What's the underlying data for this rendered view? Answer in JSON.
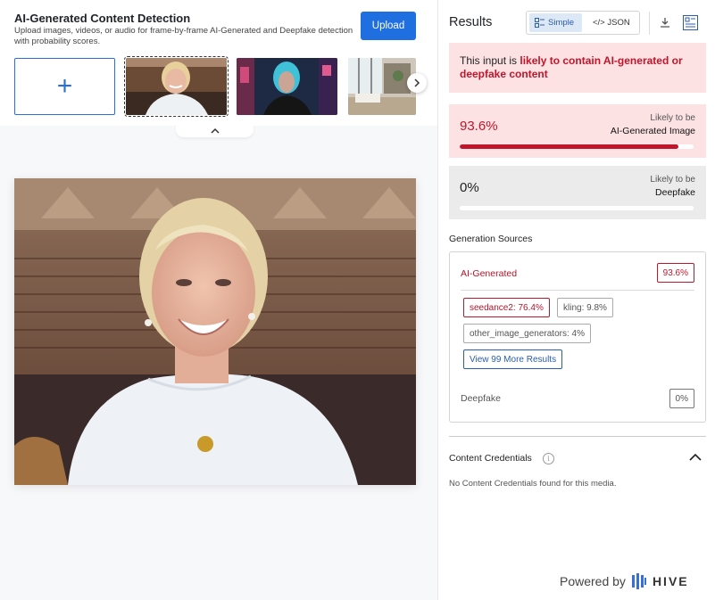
{
  "left": {
    "title": "AI-Generated Content Detection",
    "subtitle": "Upload images, videos, or audio for frame-by-frame AI-Generated and Deepfake detection with probability scores.",
    "upload_label": "Upload",
    "add_tile_glyph": "+",
    "thumbs": [
      "portrait-woman",
      "cyberpunk-woman",
      "interior-room"
    ]
  },
  "right": {
    "results_title": "Results",
    "toggle": {
      "simple": "Simple",
      "json": "</> JSON"
    },
    "alert": {
      "prefix": "This input is ",
      "emphasis": "likely to contain AI-generated or deepfake content"
    },
    "ai_card": {
      "pct": "93.6%",
      "likely": "Likely to be",
      "label": "AI-Generated Image",
      "fill": 0.936
    },
    "df_card": {
      "pct": "0%",
      "likely": "Likely to be",
      "label": "Deepfake",
      "fill": 0
    },
    "generation": {
      "title": "Generation Sources",
      "ai_label": "AI-Generated",
      "ai_pct": "93.6%",
      "sources": [
        {
          "text": "seedance2: 76.4%"
        },
        {
          "text": "kling: 9.8%"
        },
        {
          "text": "other_image_generators: 4%"
        }
      ],
      "more": "View 99 More Results",
      "df_label": "Deepfake",
      "df_pct": "0%"
    },
    "credentials": {
      "title": "Content Credentials",
      "info_glyph": "i",
      "message": "No Content Credentials found for this media."
    },
    "footer": {
      "powered": "Powered by",
      "brand": "HIVE"
    }
  },
  "colors": {
    "accent": "#1f6fe0",
    "danger": "#c0162b",
    "danger_bg": "#fde2e4"
  }
}
